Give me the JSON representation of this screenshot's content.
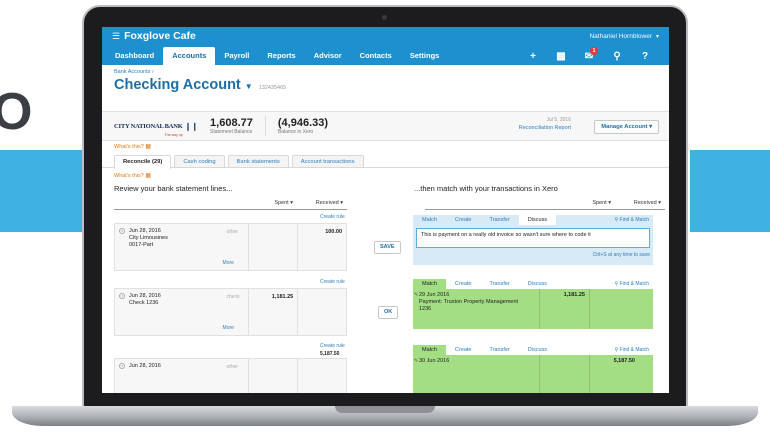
{
  "background": {
    "letter": "O",
    "band_color": "#3fb1e3"
  },
  "app": {
    "org_name": "Foxglove Cafe",
    "user_name": "Nathaniel Hornblower",
    "nav": [
      "Dashboard",
      "Accounts",
      "Payroll",
      "Reports",
      "Advisor",
      "Contacts",
      "Settings"
    ],
    "active_nav": "Accounts",
    "notification_count": "1",
    "brand_color": "#1d90d0"
  },
  "page": {
    "breadcrumb": "Bank Accounts ›",
    "title": "Checking Account",
    "account_number": "132435465"
  },
  "summary": {
    "bank_name": "CITY NATIONAL BANK",
    "bank_tagline": "The way up",
    "statement_balance": "1,608.77",
    "statement_balance_label": "Statement Balance",
    "xero_balance": "(4,946.33)",
    "xero_balance_label": "Balance in Xero",
    "recon_date": "Jul 5, 2016",
    "recon_report": "Reconciliation Report",
    "manage_button": "Manage Account"
  },
  "whats_this": "What's this?",
  "tabs": [
    "Reconcile (29)",
    "Cash coding",
    "Bank statements",
    "Account transactions"
  ],
  "left_heading": "Review your bank statement lines...",
  "right_heading": "...then match with your transactions in Xero",
  "columns": {
    "spent": "Spent",
    "received": "Received"
  },
  "create_rule": "Create rule",
  "more": "More",
  "find_match": "Find & Match",
  "statements": [
    {
      "date": "Jun 28, 2016",
      "payee": "City Limousines",
      "ref": "0017-Part",
      "type": "other",
      "spent": "",
      "received": "100.00",
      "action": "SAVE"
    },
    {
      "date": "Jun 28, 2016",
      "payee": "Check 1236",
      "ref": "",
      "type": "check",
      "spent": "1,181.25",
      "received": "",
      "action": "OK"
    },
    {
      "date": "Jun 28, 2016",
      "payee": "",
      "ref": "",
      "type": "other",
      "spent": "",
      "received": "5,187.50",
      "action": ""
    }
  ],
  "match_tabs": [
    "Match",
    "Create",
    "Transfer",
    "Discuss"
  ],
  "discuss": {
    "text": "This is payment on a really old invoice so wasn't sure where to code it",
    "shortcut": "Ctrl+S at any time to save"
  },
  "match_row": {
    "date": "29 Jun 2016",
    "description": "Payment: Truxton Property Management",
    "ref": "1236",
    "spent": "1,181.25"
  },
  "match_row_partial": {
    "date": "30 Jun 2016",
    "received": "5,187.50"
  }
}
